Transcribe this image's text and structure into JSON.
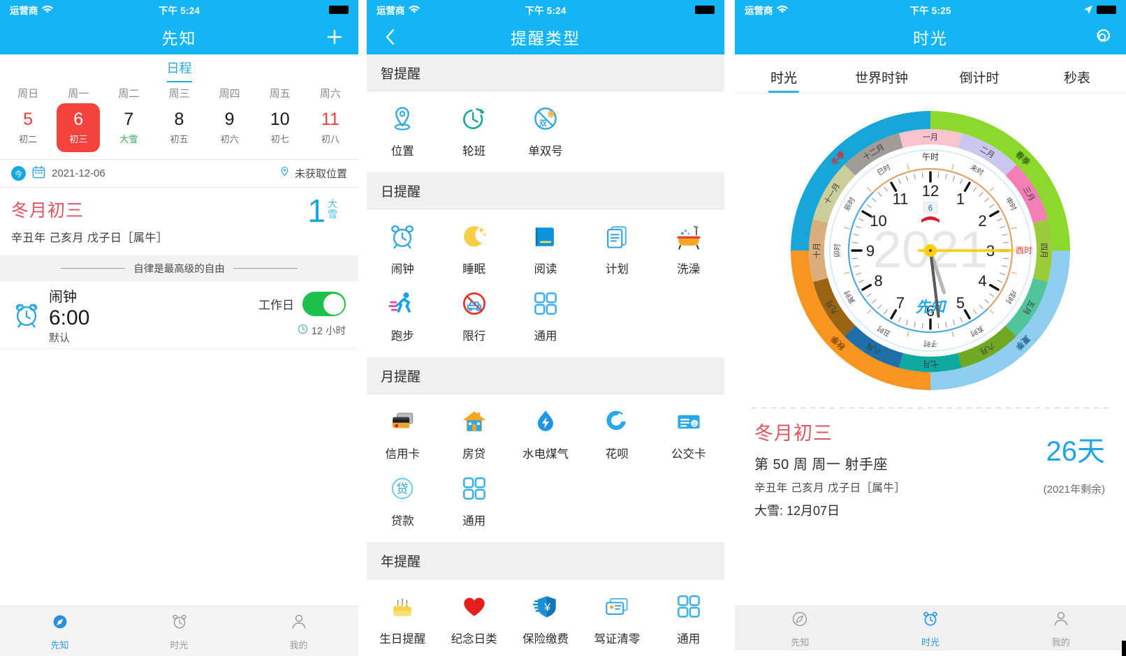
{
  "panel1": {
    "status": {
      "carrier": "运营商",
      "time": "下午 5:24"
    },
    "nav": {
      "title": "先知",
      "add_label": "+"
    },
    "tab": {
      "label": "日程"
    },
    "week": {
      "days": [
        {
          "dow": "周日",
          "num": "5",
          "sub": "初二",
          "selected": false,
          "weekend": true,
          "term": false
        },
        {
          "dow": "周一",
          "num": "6",
          "sub": "初三",
          "selected": true,
          "weekend": false,
          "term": false
        },
        {
          "dow": "周二",
          "num": "7",
          "sub": "大雪",
          "selected": false,
          "weekend": false,
          "term": true
        },
        {
          "dow": "周三",
          "num": "8",
          "sub": "初五",
          "selected": false,
          "weekend": false,
          "term": false
        },
        {
          "dow": "周四",
          "num": "9",
          "sub": "初六",
          "selected": false,
          "weekend": false,
          "term": false
        },
        {
          "dow": "周五",
          "num": "10",
          "sub": "初七",
          "selected": false,
          "weekend": false,
          "term": false
        },
        {
          "dow": "周六",
          "num": "11",
          "sub": "初八",
          "selected": false,
          "weekend": true,
          "term": false
        }
      ]
    },
    "infobar": {
      "today_badge": "今",
      "date": "2021-12-06",
      "location": "未获取位置"
    },
    "lunar": {
      "title": "冬月初三",
      "ganzhi": "辛丑年 己亥月 戊子日［属牛］",
      "countdown_num": "1",
      "countdown_label": "大雪"
    },
    "quote": "自律是最高级的自由",
    "alarm": {
      "name": "闹钟",
      "time": "6:00",
      "default_label": "默认",
      "repeat_label": "工作日",
      "duration": "12 小时",
      "enabled": true
    },
    "tabbar": [
      {
        "label": "先知",
        "icon": "compass-icon",
        "active": true
      },
      {
        "label": "时光",
        "icon": "alarm-clock-icon",
        "active": false
      },
      {
        "label": "我的",
        "icon": "person-icon",
        "active": false
      }
    ]
  },
  "panel2": {
    "status": {
      "carrier": "运营商",
      "time": "下午 5:24"
    },
    "nav": {
      "title": "提醒类型",
      "back_icon": "chevron-left-icon"
    },
    "sections": [
      {
        "title": "智提醒",
        "items": [
          {
            "label": "位置",
            "icon": "map-pin-icon"
          },
          {
            "label": "轮班",
            "icon": "shift-clock-icon"
          },
          {
            "label": "单双号",
            "icon": "odd-even-plate-icon"
          }
        ]
      },
      {
        "title": "日提醒",
        "items": [
          {
            "label": "闹钟",
            "icon": "alarm-clock-icon"
          },
          {
            "label": "睡眠",
            "icon": "moon-icon"
          },
          {
            "label": "阅读",
            "icon": "book-icon"
          },
          {
            "label": "计划",
            "icon": "document-stack-icon"
          },
          {
            "label": "洗澡",
            "icon": "bathtub-icon"
          },
          {
            "label": "跑步",
            "icon": "running-icon"
          },
          {
            "label": "限行",
            "icon": "no-car-icon"
          },
          {
            "label": "通用",
            "icon": "grid-squares-icon"
          }
        ]
      },
      {
        "title": "月提醒",
        "items": [
          {
            "label": "信用卡",
            "icon": "credit-card-icon"
          },
          {
            "label": "房贷",
            "icon": "house-icon"
          },
          {
            "label": "水电煤气",
            "icon": "water-drop-bolt-icon"
          },
          {
            "label": "花呗",
            "icon": "huabei-icon"
          },
          {
            "label": "公交卡",
            "icon": "transit-card-icon"
          },
          {
            "label": "贷款",
            "icon": "loan-circle-icon"
          },
          {
            "label": "通用",
            "icon": "grid-squares-icon"
          }
        ]
      },
      {
        "title": "年提醒",
        "items": [
          {
            "label": "生日提醒",
            "icon": "birthday-cake-icon"
          },
          {
            "label": "纪念日类",
            "icon": "heart-icon"
          },
          {
            "label": "保险缴费",
            "icon": "shield-yen-icon"
          },
          {
            "label": "驾证清零",
            "icon": "license-card-icon"
          },
          {
            "label": "通用",
            "icon": "grid-squares-icon"
          }
        ]
      }
    ]
  },
  "panel3": {
    "status": {
      "carrier": "运营商",
      "time": "下午 5:25"
    },
    "nav": {
      "title": "时光",
      "settings_icon": "gear-icon"
    },
    "tabs": [
      {
        "label": "时光",
        "active": true
      },
      {
        "label": "世界时钟",
        "active": false
      },
      {
        "label": "倒计时",
        "active": false
      },
      {
        "label": "秒表",
        "active": false
      }
    ],
    "clock": {
      "center_year": "2021",
      "brand": "先知",
      "date_badge": "6",
      "hour_numerals": [
        "12",
        "1",
        "2",
        "3",
        "4",
        "5",
        "6",
        "7",
        "8",
        "9",
        "10",
        "11"
      ],
      "noon_label": "午时",
      "酉_label": "酉时",
      "hour_branches": [
        "午时",
        "未时",
        "申时",
        "酉时",
        "戌时",
        "亥时",
        "子时",
        "丑时",
        "寅时",
        "卯时",
        "辰时",
        "巳时"
      ],
      "months": [
        "一月",
        "二月",
        "三月",
        "四月",
        "五月",
        "六月",
        "七月",
        "八月",
        "九月",
        "十月",
        "十一月",
        "十二月"
      ],
      "seasons": [
        "春季",
        "夏季",
        "秋季",
        "冬季"
      ],
      "hands": {
        "hour_deg": 162,
        "minute_deg": 144,
        "second_deg": 90
      }
    },
    "info": {
      "lunar": "冬月初三",
      "week": "第 50 周  周一   射手座",
      "ganzhi": "辛丑年 己亥月 戊子日［属牛］",
      "term": "大雪: 12月07日",
      "days_left": "26天",
      "days_note": "(2021年剩余)"
    },
    "tabbar": [
      {
        "label": "先知",
        "icon": "compass-icon",
        "active": false
      },
      {
        "label": "时光",
        "icon": "alarm-clock-icon",
        "active": true
      },
      {
        "label": "我的",
        "icon": "person-icon",
        "active": false
      }
    ]
  },
  "colors": {
    "brand_blue": "#13B5F5",
    "accent_blue": "#19A7E0",
    "red": "#F4433C",
    "lunar_red": "#E0555F",
    "green_toggle": "#1DC14A",
    "term_green": "#3CA85A",
    "section_bg": "#F0F0F0"
  }
}
